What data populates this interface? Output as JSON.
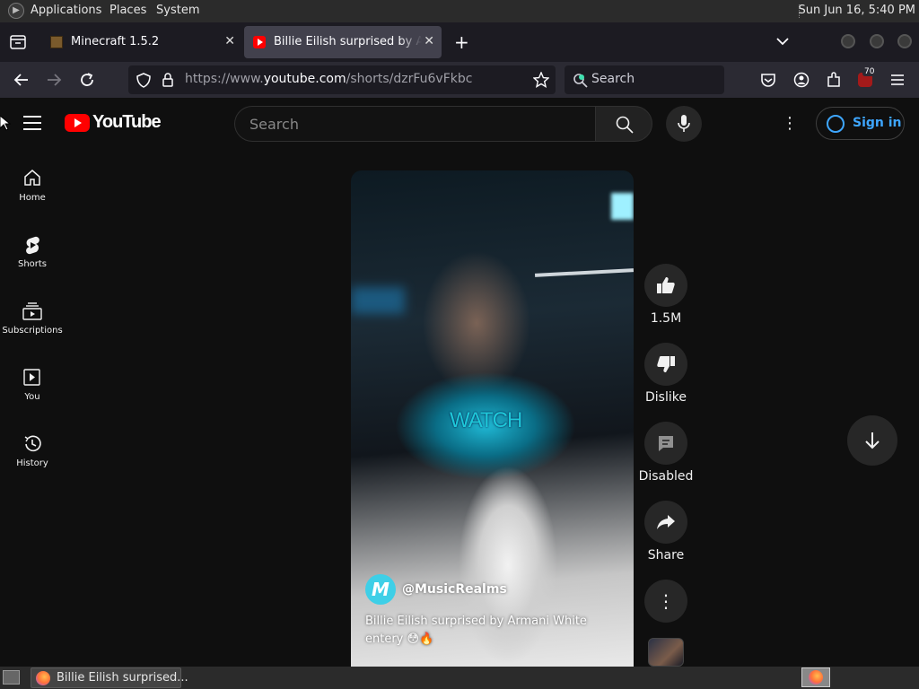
{
  "panel": {
    "applications": "Applications",
    "places": "Places",
    "system": "System",
    "clock": "Sun Jun 16,  5:40 PM"
  },
  "tabs": [
    {
      "title": "Minecraft 1.5.2",
      "icon": "minecraft-icon"
    },
    {
      "title": "Billie Eilish surprised by Armani White entery",
      "icon": "youtube-favicon",
      "active": true
    }
  ],
  "toolbar": {
    "url_prefix": "https://www.",
    "url_host": "youtube.com",
    "url_path": "/shorts/dzrFu6vFkbc",
    "search_placeholder": "Search",
    "extension_badge": "70"
  },
  "youtube": {
    "logo_text": "YouTube",
    "search_placeholder": "Search",
    "sign_in": "Sign in",
    "sidebar": [
      {
        "label": "Home",
        "icon": "home-icon"
      },
      {
        "label": "Shorts",
        "icon": "shorts-icon"
      },
      {
        "label": "Subscriptions",
        "icon": "subscriptions-icon"
      },
      {
        "label": "You",
        "icon": "you-icon"
      },
      {
        "label": "History",
        "icon": "history-icon"
      }
    ],
    "short": {
      "overlay_text": "WATCH",
      "channel": "@MusicRealms",
      "channel_avatar_letter": "M",
      "caption": "Billie Eilish surprised by Armani White entery 😳🔥"
    },
    "actions": {
      "like": "1.5M",
      "dislike": "Dislike",
      "comments": "Disabled",
      "share": "Share"
    }
  },
  "taskbar": {
    "window_title": "Billie Eilish surprised..."
  },
  "colors": {
    "yt_red": "#ff0000",
    "link_blue": "#3ea6ff",
    "background": "#0f0f0f"
  }
}
